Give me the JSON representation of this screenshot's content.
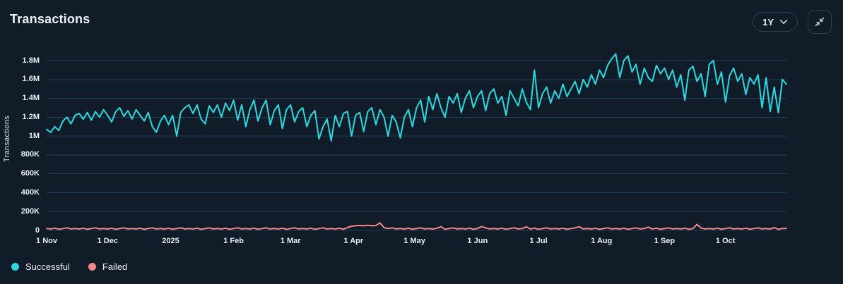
{
  "header": {
    "title": "Transactions"
  },
  "controls": {
    "range_label": "1Y",
    "range_icon": "chevron-down",
    "collapse_icon": "collapse-arrows"
  },
  "colors": {
    "background": "#111c29",
    "grid": "#1f4055",
    "tick_text": "#e9edf1",
    "successful": "#2bd9e0",
    "failed": "#f4868d",
    "border": "#32404e"
  },
  "chart_data": {
    "type": "line",
    "title": "Transactions",
    "ylabel": "Transactions",
    "unit": "millions",
    "legend_position": "bottom-left",
    "grid": "horizontal",
    "ylim": [
      0,
      1.9
    ],
    "x_end_days": 364,
    "sample_interval_days": 2,
    "x_ticks": [
      {
        "day": 0,
        "label": "1 Nov"
      },
      {
        "day": 30,
        "label": "1 Dec"
      },
      {
        "day": 61,
        "label": "2025"
      },
      {
        "day": 92,
        "label": "1 Feb"
      },
      {
        "day": 120,
        "label": "1 Mar"
      },
      {
        "day": 151,
        "label": "1 Apr"
      },
      {
        "day": 181,
        "label": "1 May"
      },
      {
        "day": 212,
        "label": "1 Jun"
      },
      {
        "day": 242,
        "label": "1 Jul"
      },
      {
        "day": 273,
        "label": "1 Aug"
      },
      {
        "day": 304,
        "label": "1 Sep"
      },
      {
        "day": 334,
        "label": "1 Oct"
      }
    ],
    "y_ticks": [
      {
        "value": 0,
        "label": "0"
      },
      {
        "value": 0.2,
        "label": "200K"
      },
      {
        "value": 0.4,
        "label": "400K"
      },
      {
        "value": 0.6,
        "label": "600K"
      },
      {
        "value": 0.8,
        "label": "800K"
      },
      {
        "value": 1.0,
        "label": "1M"
      },
      {
        "value": 1.2,
        "label": "1.2M"
      },
      {
        "value": 1.4,
        "label": "1.4M"
      },
      {
        "value": 1.6,
        "label": "1.6M"
      },
      {
        "value": 1.8,
        "label": "1.8M"
      }
    ],
    "series": [
      {
        "name": "Successful",
        "color": "#2bd9e0",
        "values": [
          1.07,
          1.04,
          1.1,
          1.06,
          1.16,
          1.2,
          1.13,
          1.22,
          1.24,
          1.18,
          1.25,
          1.17,
          1.26,
          1.2,
          1.28,
          1.22,
          1.15,
          1.26,
          1.3,
          1.21,
          1.27,
          1.18,
          1.28,
          1.22,
          1.16,
          1.25,
          1.1,
          1.04,
          1.16,
          1.22,
          1.12,
          1.22,
          1.0,
          1.25,
          1.3,
          1.33,
          1.24,
          1.33,
          1.18,
          1.13,
          1.32,
          1.25,
          1.33,
          1.2,
          1.35,
          1.27,
          1.38,
          1.17,
          1.33,
          1.1,
          1.28,
          1.38,
          1.16,
          1.3,
          1.38,
          1.12,
          1.27,
          1.33,
          1.08,
          1.28,
          1.33,
          1.15,
          1.26,
          1.3,
          1.1,
          1.22,
          1.27,
          0.97,
          1.1,
          1.18,
          0.95,
          1.22,
          1.1,
          1.24,
          1.26,
          1.0,
          1.22,
          1.25,
          1.05,
          1.26,
          1.3,
          1.12,
          1.28,
          1.2,
          1.0,
          1.22,
          1.15,
          0.98,
          1.2,
          1.28,
          1.1,
          1.3,
          1.38,
          1.15,
          1.42,
          1.28,
          1.45,
          1.3,
          1.2,
          1.42,
          1.35,
          1.45,
          1.25,
          1.4,
          1.48,
          1.3,
          1.42,
          1.48,
          1.27,
          1.45,
          1.5,
          1.35,
          1.42,
          1.22,
          1.48,
          1.4,
          1.32,
          1.5,
          1.36,
          1.28,
          1.7,
          1.3,
          1.45,
          1.52,
          1.35,
          1.48,
          1.4,
          1.55,
          1.42,
          1.5,
          1.58,
          1.45,
          1.6,
          1.52,
          1.65,
          1.55,
          1.7,
          1.62,
          1.75,
          1.82,
          1.87,
          1.62,
          1.8,
          1.85,
          1.68,
          1.76,
          1.55,
          1.72,
          1.62,
          1.58,
          1.75,
          1.66,
          1.72,
          1.6,
          1.7,
          1.52,
          1.65,
          1.38,
          1.7,
          1.74,
          1.58,
          1.66,
          1.42,
          1.76,
          1.8,
          1.55,
          1.68,
          1.36,
          1.64,
          1.72,
          1.58,
          1.66,
          1.44,
          1.62,
          1.55,
          1.65,
          1.3,
          1.62,
          1.26,
          1.52,
          1.25,
          1.6,
          1.55
        ]
      },
      {
        "name": "Failed",
        "color": "#f4868d",
        "values": [
          0.02,
          0.015,
          0.024,
          0.012,
          0.02,
          0.028,
          0.016,
          0.02,
          0.015,
          0.024,
          0.012,
          0.02,
          0.028,
          0.016,
          0.02,
          0.015,
          0.024,
          0.012,
          0.02,
          0.028,
          0.016,
          0.02,
          0.015,
          0.024,
          0.012,
          0.02,
          0.028,
          0.016,
          0.02,
          0.015,
          0.024,
          0.012,
          0.02,
          0.028,
          0.016,
          0.02,
          0.015,
          0.024,
          0.012,
          0.02,
          0.028,
          0.016,
          0.02,
          0.015,
          0.024,
          0.012,
          0.02,
          0.028,
          0.016,
          0.02,
          0.015,
          0.024,
          0.012,
          0.02,
          0.028,
          0.016,
          0.02,
          0.015,
          0.024,
          0.012,
          0.02,
          0.028,
          0.016,
          0.02,
          0.015,
          0.024,
          0.012,
          0.02,
          0.028,
          0.016,
          0.02,
          0.015,
          0.024,
          0.012,
          0.03,
          0.045,
          0.05,
          0.052,
          0.05,
          0.054,
          0.05,
          0.052,
          0.08,
          0.03,
          0.02,
          0.028,
          0.016,
          0.02,
          0.015,
          0.024,
          0.012,
          0.02,
          0.028,
          0.016,
          0.02,
          0.015,
          0.024,
          0.04,
          0.012,
          0.02,
          0.028,
          0.016,
          0.02,
          0.015,
          0.024,
          0.012,
          0.02,
          0.042,
          0.028,
          0.016,
          0.02,
          0.015,
          0.024,
          0.012,
          0.02,
          0.028,
          0.016,
          0.02,
          0.038,
          0.015,
          0.024,
          0.012,
          0.02,
          0.028,
          0.016,
          0.02,
          0.015,
          0.024,
          0.012,
          0.02,
          0.028,
          0.04,
          0.016,
          0.02,
          0.015,
          0.024,
          0.012,
          0.02,
          0.028,
          0.016,
          0.02,
          0.015,
          0.024,
          0.012,
          0.02,
          0.028,
          0.016,
          0.02,
          0.035,
          0.015,
          0.024,
          0.012,
          0.02,
          0.028,
          0.016,
          0.02,
          0.015,
          0.024,
          0.012,
          0.02,
          0.065,
          0.025,
          0.016,
          0.02,
          0.015,
          0.024,
          0.012,
          0.02,
          0.028,
          0.016,
          0.02,
          0.015,
          0.024,
          0.012,
          0.02,
          0.028,
          0.016,
          0.02,
          0.015,
          0.03,
          0.012,
          0.02,
          0.022
        ]
      }
    ]
  }
}
